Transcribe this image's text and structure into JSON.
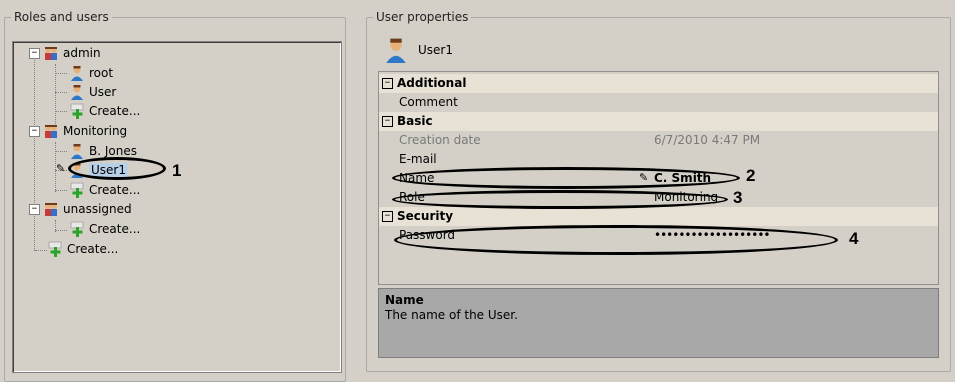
{
  "left_panel": {
    "title": "Roles and users",
    "tree": {
      "role_admin": "admin",
      "user_root": "root",
      "user_user": "User",
      "create_admin": "Create...",
      "role_monitoring": "Monitoring",
      "user_bjones": "B. Jones",
      "user_user1": "User1",
      "create_monitoring": "Create...",
      "role_unassigned": "unassigned",
      "create_unassigned": "Create...",
      "create_root": "Create..."
    }
  },
  "right_panel": {
    "title": "User properties",
    "header_name": "User1",
    "categories": {
      "additional": "Additional",
      "basic": "Basic",
      "security": "Security"
    },
    "properties": {
      "comment": {
        "label": "Comment",
        "value": ""
      },
      "creation_date": {
        "label": "Creation date",
        "value": "6/7/2010 4:47 PM"
      },
      "email": {
        "label": "E-mail",
        "value": ""
      },
      "name": {
        "label": "Name",
        "value": "C. Smith"
      },
      "role": {
        "label": "Role",
        "value": "Monitoring"
      },
      "password": {
        "label": "Password",
        "value": "•••••••••••••••••••"
      }
    },
    "description": {
      "title": "Name",
      "text": "The name of the User."
    }
  },
  "callouts": [
    "1",
    "2",
    "3",
    "4"
  ],
  "colors": {
    "window_bg": "#d4d0c8",
    "category_bg": "#e8e2d6",
    "description_bg": "#a8a8a8",
    "create_plus": "#2aa52a"
  }
}
